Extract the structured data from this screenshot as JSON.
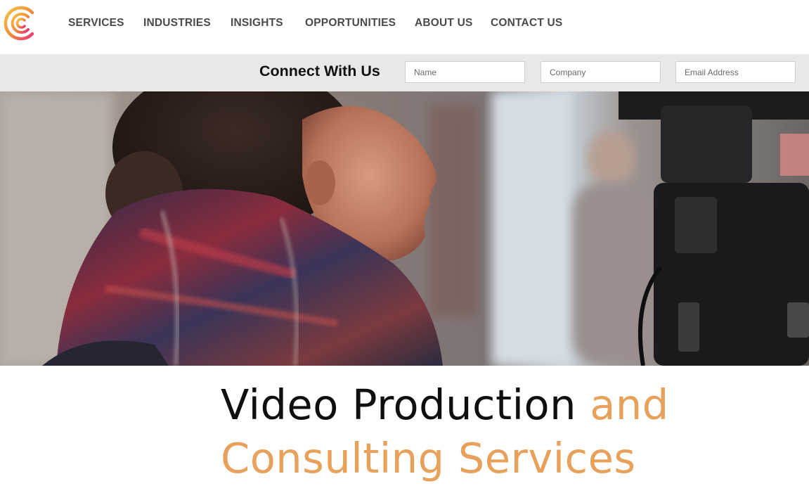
{
  "nav": {
    "items": [
      {
        "label": "SERVICES"
      },
      {
        "label": "INDUSTRIES"
      },
      {
        "label": "INSIGHTS"
      },
      {
        "label": "OPPORTUNITIES"
      },
      {
        "label": "ABOUT US"
      },
      {
        "label": "CONTACT US"
      }
    ]
  },
  "connect": {
    "title": "Connect With Us",
    "name_placeholder": "Name",
    "company_placeholder": "Company",
    "email_placeholder": "Email Address"
  },
  "hero": {
    "image": "photo of a woman in a plaid scarf looking toward a film camera"
  },
  "headline": {
    "part1": "Video Production ",
    "part2": "and",
    "part3": "Consulting Services"
  },
  "colors": {
    "accent": "#e7a15a",
    "bar_background": "#e9e8e6",
    "nav_text": "#4a4a4a"
  }
}
